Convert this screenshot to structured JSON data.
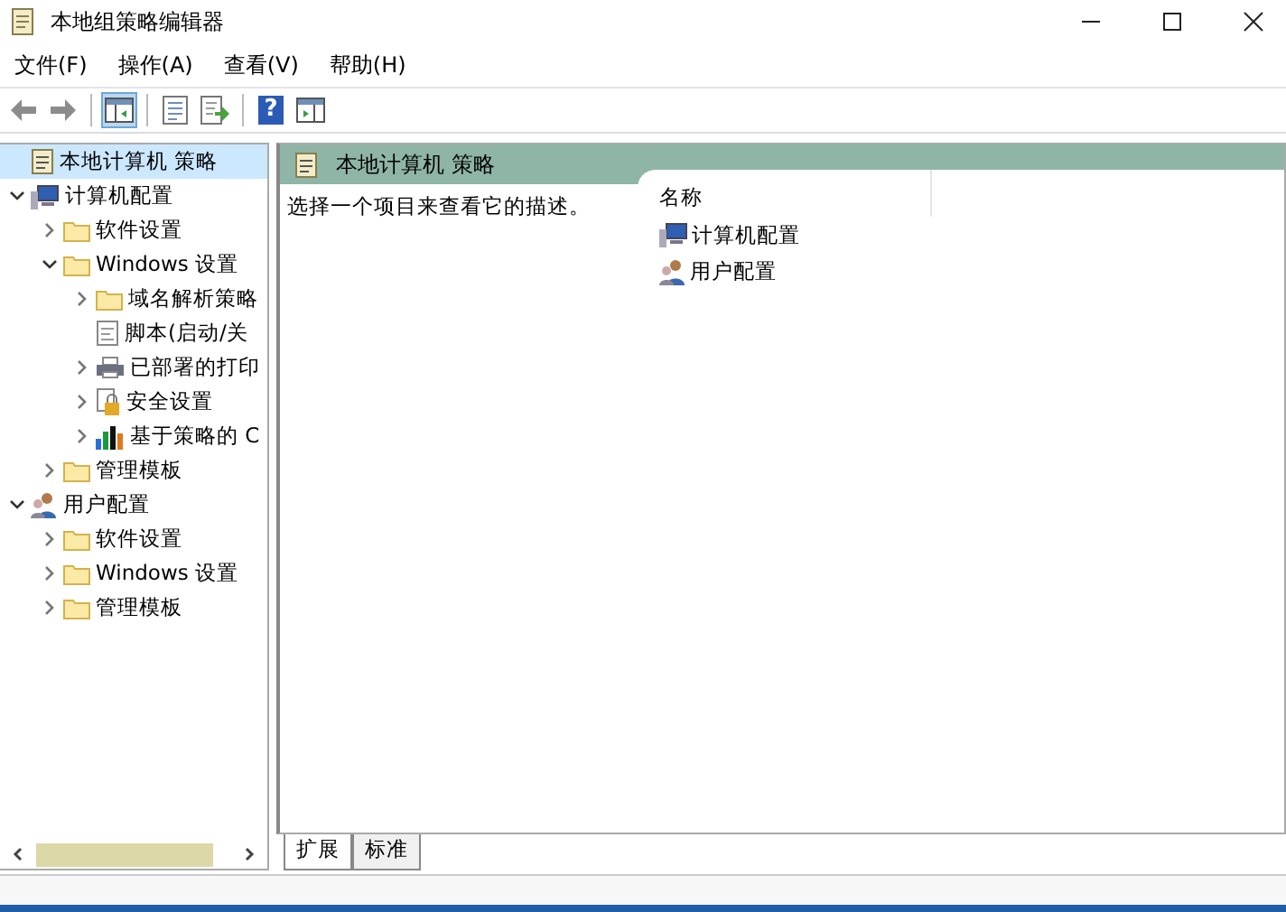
{
  "window": {
    "title": "本地组策略编辑器"
  },
  "menu": [
    "文件(F)",
    "操作(A)",
    "查看(V)",
    "帮助(H)"
  ],
  "toolbar": [
    {
      "kind": "back",
      "pressed": false
    },
    {
      "kind": "forward",
      "pressed": false
    },
    {
      "kind": "separator"
    },
    {
      "kind": "tree-pane",
      "pressed": true
    },
    {
      "kind": "separator"
    },
    {
      "kind": "properties",
      "pressed": false
    },
    {
      "kind": "export",
      "pressed": false
    },
    {
      "kind": "separator"
    },
    {
      "kind": "help",
      "label": "?",
      "pressed": false
    },
    {
      "kind": "action-pane",
      "pressed": false
    }
  ],
  "tree": [
    {
      "label": "本地计算机 策略",
      "kind": "policy",
      "selected": true
    },
    {
      "label": "计算机配置",
      "kind": "computer",
      "expanded": true,
      "selected": false,
      "children": [
        {
          "label": "软件设置",
          "kind": "folder",
          "expanded": false,
          "selected": false
        },
        {
          "label": "Windows 设置",
          "kind": "folder",
          "expanded": true,
          "selected": false,
          "children": [
            {
              "label": "域名解析策略",
              "kind": "folder",
              "expanded": false,
              "selected": false
            },
            {
              "label": "脚本(启动/关",
              "kind": "script",
              "selected": false
            },
            {
              "label": "已部署的打印",
              "kind": "printer",
              "expanded": false,
              "selected": false
            },
            {
              "label": "安全设置",
              "kind": "security",
              "expanded": false,
              "selected": false
            },
            {
              "label": "基于策略的 C",
              "kind": "chart",
              "expanded": false,
              "selected": false
            }
          ]
        },
        {
          "label": "管理模板",
          "kind": "folder",
          "expanded": false,
          "selected": false
        }
      ]
    },
    {
      "label": "用户配置",
      "kind": "user",
      "expanded": true,
      "selected": false,
      "children": [
        {
          "label": "软件设置",
          "kind": "folder",
          "expanded": false,
          "selected": false
        },
        {
          "label": "Windows 设置",
          "kind": "folder",
          "expanded": false,
          "selected": false
        },
        {
          "label": "管理模板",
          "kind": "folder",
          "expanded": false,
          "selected": false
        }
      ]
    }
  ],
  "details": {
    "title": "本地计算机 策略",
    "description": "选择一个项目来查看它的描述。",
    "column": "名称",
    "items": [
      {
        "label": "计算机配置",
        "kind": "computer"
      },
      {
        "label": "用户配置",
        "kind": "user"
      }
    ]
  },
  "tabs": [
    {
      "label": "扩展",
      "selected": true
    },
    {
      "label": "标准",
      "selected": false
    }
  ]
}
